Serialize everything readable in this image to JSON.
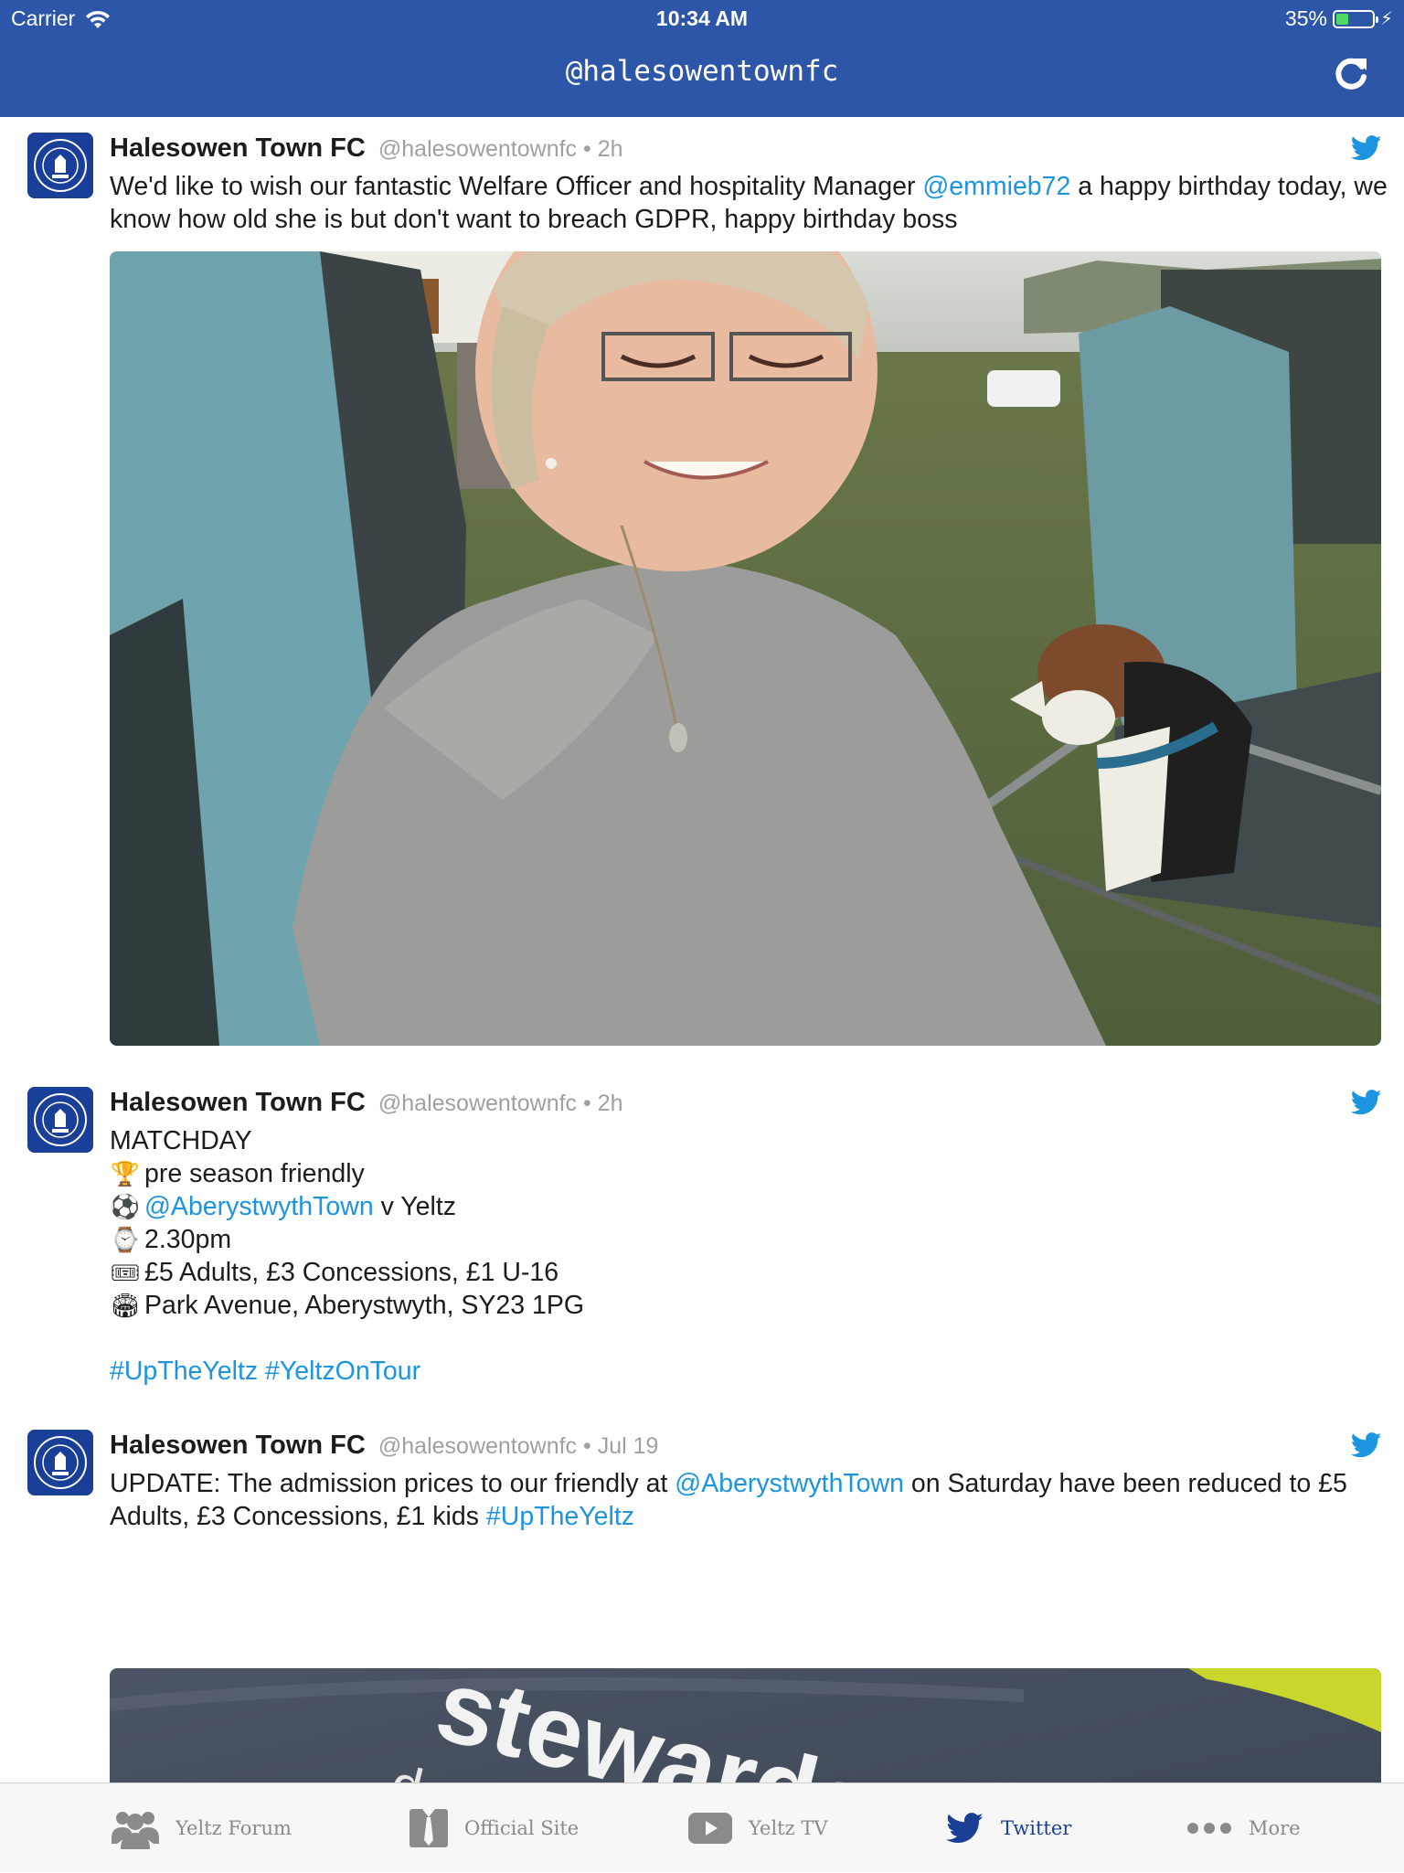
{
  "status_bar": {
    "carrier": "Carrier",
    "time": "10:34 AM",
    "battery_pct": "35%",
    "battery_level": 0.35
  },
  "nav": {
    "title": "@halesowentownfc",
    "refresh_icon": "refresh-icon"
  },
  "tweets": [
    {
      "name": "Halesowen Town FC",
      "meta": "@halesowentownfc • 2h",
      "text_a": "We'd like to wish our fantastic Welfare Officer and hospitality Manager ",
      "mention": "@emmieb72",
      "text_b": " a happy birthday today, we know how old she is but don't want to breach GDPR, happy birthday boss",
      "photo": "smiling-woman-with-dog-on-camping-chair"
    },
    {
      "name": "Halesowen Town FC",
      "meta": "@halesowentownfc • 2h",
      "line1": "MATCHDAY",
      "line2": "pre season friendly",
      "line3_link": "@AberystwythTown",
      "line3_text": " v Yeltz",
      "line4": "2.30pm",
      "line5": "£5 Adults, £3 Concessions, £1 U-16",
      "line6": "Park Avenue, Aberystwyth, SY23 1PG",
      "hashtags": "#UpTheYeltz #YeltzOnTour",
      "emojis": [
        "trophy-icon",
        "soccer-ball-icon",
        "watch-icon",
        "ticket-icon",
        "stadium-icon"
      ]
    },
    {
      "name": "Halesowen Town FC",
      "meta": "@halesowentownfc • Jul 19",
      "text_a": "UPDATE: The admission prices to our friendly at ",
      "mention": "@AberystwythTown",
      "text_b": " on Saturday have been reduced to £5 Adults, £3 Concessions, £1 kids ",
      "hashtag": "#UpTheYeltz",
      "photo_text_1": "stewards",
      "photo_text_2": "develop"
    }
  ],
  "tabs": [
    {
      "label": "Yeltz Forum",
      "icon": "group-icon"
    },
    {
      "label": "Official Site",
      "icon": "site-icon"
    },
    {
      "label": "Yeltz TV",
      "icon": "play-icon"
    },
    {
      "label": "Twitter",
      "icon": "twitter-icon",
      "active": true
    },
    {
      "label": "More",
      "icon": "more-icon"
    }
  ],
  "colors": {
    "nav": "#2d56a9",
    "link": "#1c94e0",
    "active_tab": "#1b3f94"
  }
}
